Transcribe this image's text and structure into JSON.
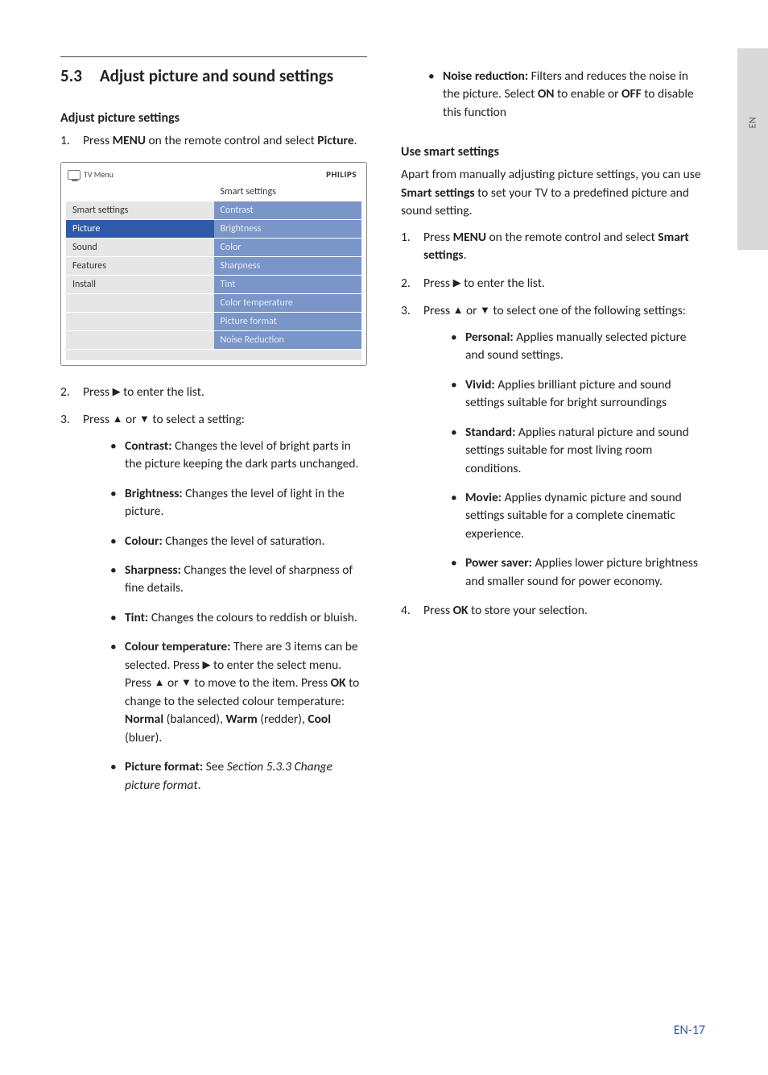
{
  "side_tab": "EN",
  "section": {
    "num": "5.3",
    "title": "Adjust picture and sound settings"
  },
  "left": {
    "sub1": "Adjust picture settings",
    "step1_a": "Press ",
    "step1_b": "MENU",
    "step1_c": " on the remote control and select ",
    "step1_d": "Picture",
    "step1_e": ".",
    "tv": {
      "title": "TV Menu",
      "logo": "PHILIPS",
      "left": [
        "Smart settings",
        "Picture",
        "Sound",
        "Features",
        "Install"
      ],
      "right_head": "Smart settings",
      "right": [
        "Contrast",
        "Brightness",
        "Color",
        "Sharpness",
        "Tint",
        "Color temperature",
        "Picture format",
        "Noise Reduction"
      ]
    },
    "step2_a": "Press ",
    "step2_b": " to enter the list.",
    "step3_a": "Press ",
    "step3_b": " or ",
    "step3_c": " to select a setting:",
    "bullets": {
      "contrast_l": "Contrast:",
      "contrast_t": " Changes the level of bright parts in the picture keeping the dark parts unchanged.",
      "brightness_l": "Brightness:",
      "brightness_t": " Changes the level of light in the picture.",
      "colour_l": "Colour:",
      "colour_t": " Changes the level of saturation.",
      "sharpness_l": "Sharpness:",
      "sharpness_t": " Changes the level of sharpness of fine details.",
      "tint_l": "Tint:",
      "tint_t": " Changes the colours to reddish or bluish.",
      "ct_l": "Colour temperature:",
      "ct_1": " There are 3 items can be selected. Press ",
      "ct_2": " to enter the select menu. Press ",
      "ct_3": " or ",
      "ct_4": " to move to the item. Press ",
      "ct_ok": "OK",
      "ct_5": " to change to the selected colour temperature: ",
      "ct_n": "Normal",
      "ct_6": " (balanced), ",
      "ct_w": "Warm",
      "ct_7": " (redder), ",
      "ct_c": "Cool",
      "ct_8": " (bluer).",
      "pf_l": "Picture format:",
      "pf_1": " See ",
      "pf_i": "Section 5.3.3 Change picture format",
      "pf_2": "."
    }
  },
  "right": {
    "nr_l": "Noise reduction:",
    "nr_1": " Filters and reduces the noise in the picture. Select ",
    "nr_on": "ON",
    "nr_2": " to enable or ",
    "nr_off": "OFF",
    "nr_3": " to disable this function",
    "sub": "Use smart settings",
    "intro_a": "Apart from manually adjusting picture settings, you can use ",
    "intro_b": "Smart settings",
    "intro_c": " to set your TV to a predefined picture and sound setting.",
    "s1_a": "Press ",
    "s1_b": "MENU",
    "s1_c": " on the remote control and select ",
    "s1_d": "Smart settings",
    "s1_e": ".",
    "s2_a": "Press ",
    "s2_b": " to enter the list.",
    "s3_a": "Press ",
    "s3_b": " or ",
    "s3_c": " to select one of the following settings:",
    "opts": {
      "p_l": "Personal:",
      "p_t": " Applies manually selected picture and sound settings.",
      "v_l": "Vivid:",
      "v_t": " Applies brilliant picture and sound settings suitable for bright surroundings",
      "st_l": "Standard:",
      "st_t": " Applies natural picture and sound settings suitable for most living room conditions.",
      "m_l": "Movie:",
      "m_t": " Applies dynamic picture and sound settings suitable for a complete cinematic experience.",
      "ps_l": "Power saver:",
      "ps_t": " Applies lower picture brightness and smaller sound for power economy."
    },
    "s4_a": "Press ",
    "s4_b": "OK",
    "s4_c": " to store your selection."
  },
  "glyph": {
    "right": "▶",
    "up": "▲",
    "down": "▼"
  },
  "footer": "EN-17"
}
